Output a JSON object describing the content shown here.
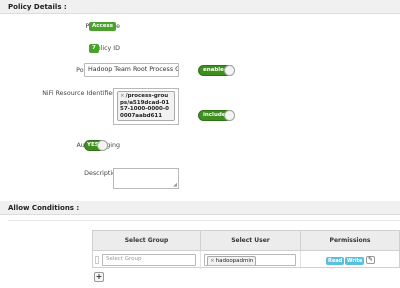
{
  "policy_details": {
    "header": "Policy Details :",
    "policy_type": {
      "label": "Policy Type",
      "value": "Access"
    },
    "policy_id": {
      "label": "Policy ID",
      "value": "7"
    },
    "policy_name": {
      "label": "Policy Name *",
      "value": "Hadoop Team Root Process Group",
      "toggle": "enabled"
    },
    "nifi_resource": {
      "label": "NiFi Resource Identifier *",
      "tag_value": "/process-groups/a519dcad-0157-1000-0000-00007aabd611",
      "toggle": "include"
    },
    "audit_logging": {
      "label": "Audit Logging",
      "toggle": "YES"
    },
    "description": {
      "label": "Description",
      "value": ""
    }
  },
  "allow_conditions": {
    "header": "Allow Conditions :",
    "columns": [
      "Select Group",
      "Select User",
      "Permissions"
    ],
    "rows": [
      {
        "group_placeholder": "Select Group",
        "user_tag": "hadoopadmin",
        "permissions": [
          "Read",
          "Write"
        ]
      }
    ],
    "add_label": "+"
  },
  "colors": {
    "toggle_green": "#3e8e20",
    "badge_green": "#4aa22c",
    "permission_blue": "#5bc0de"
  }
}
